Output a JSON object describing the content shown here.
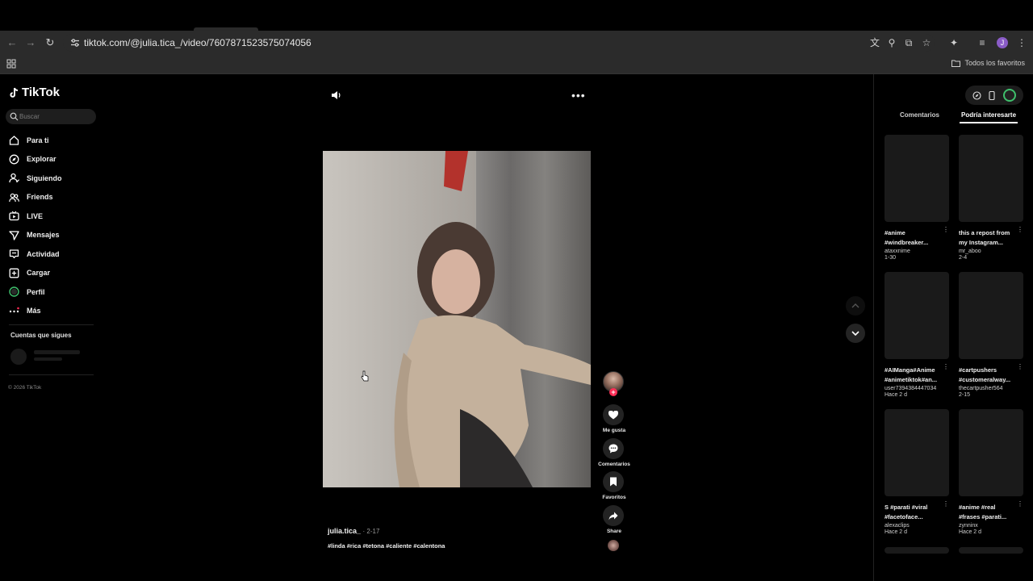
{
  "browser": {
    "url": "tiktok.com/@julia.tica_/video/7607871523575074056",
    "bookmarks_all": "Todos los favoritos",
    "profile_initial": "J"
  },
  "tiktok": {
    "logo": "TikTok",
    "search_placeholder": "Buscar",
    "nav": [
      {
        "label": "Para ti",
        "icon": "home-icon"
      },
      {
        "label": "Explorar",
        "icon": "compass-icon"
      },
      {
        "label": "Siguiendo",
        "icon": "person-follow-icon"
      },
      {
        "label": "Friends",
        "icon": "friends-icon"
      },
      {
        "label": "LIVE",
        "icon": "live-tv-icon"
      },
      {
        "label": "Mensajes",
        "icon": "paper-plane-icon"
      },
      {
        "label": "Actividad",
        "icon": "inbox-icon"
      },
      {
        "label": "Cargar",
        "icon": "plus-square-icon"
      },
      {
        "label": "Perfil",
        "icon": "profile-avatar-icon"
      },
      {
        "label": "Más",
        "icon": "more-dots-icon"
      }
    ],
    "following_header": "Cuentas que sigues",
    "copyright": "© 2026 TikTok"
  },
  "video": {
    "author": "julia.tica_",
    "date": "· 2-17",
    "hashtags": "#linda #rica #tetona #caliente #calentona",
    "actions": {
      "like": "Me gusta",
      "comments": "Comentarios",
      "favorites": "Favoritos",
      "share": "Share"
    }
  },
  "right_panel": {
    "tabs": [
      "Comentarios",
      "Podría interesarte"
    ],
    "active_tab": "Podría interesarte",
    "cards": [
      {
        "title1": "#anime",
        "title2": "#windbreaker...",
        "user": "ataxxnime",
        "ago": "1-30"
      },
      {
        "title1": "this a repost from",
        "title2": "my Instagram...",
        "user": "mr_aboo",
        "ago": "2-4"
      },
      {
        "title1": "#AIManga#Anime",
        "title2": "#animetiktok#an...",
        "user": "user7394384447034",
        "ago": "Hace 2 d"
      },
      {
        "title1": "#cartpushers",
        "title2": "#customeralway...",
        "user": "thecartpusher564",
        "ago": "2-15"
      },
      {
        "title1": "S #parati #viral",
        "title2": "#facetoface...",
        "user": "alexaclips",
        "ago": "Hace 2 d"
      },
      {
        "title1": "#anime #real",
        "title2": "#frases #parati...",
        "user": "zynninx",
        "ago": "Hace 2 d"
      }
    ]
  },
  "colors": {
    "accent": "#fe2c55",
    "background": "#000000",
    "panel": "#1a1a1a"
  }
}
